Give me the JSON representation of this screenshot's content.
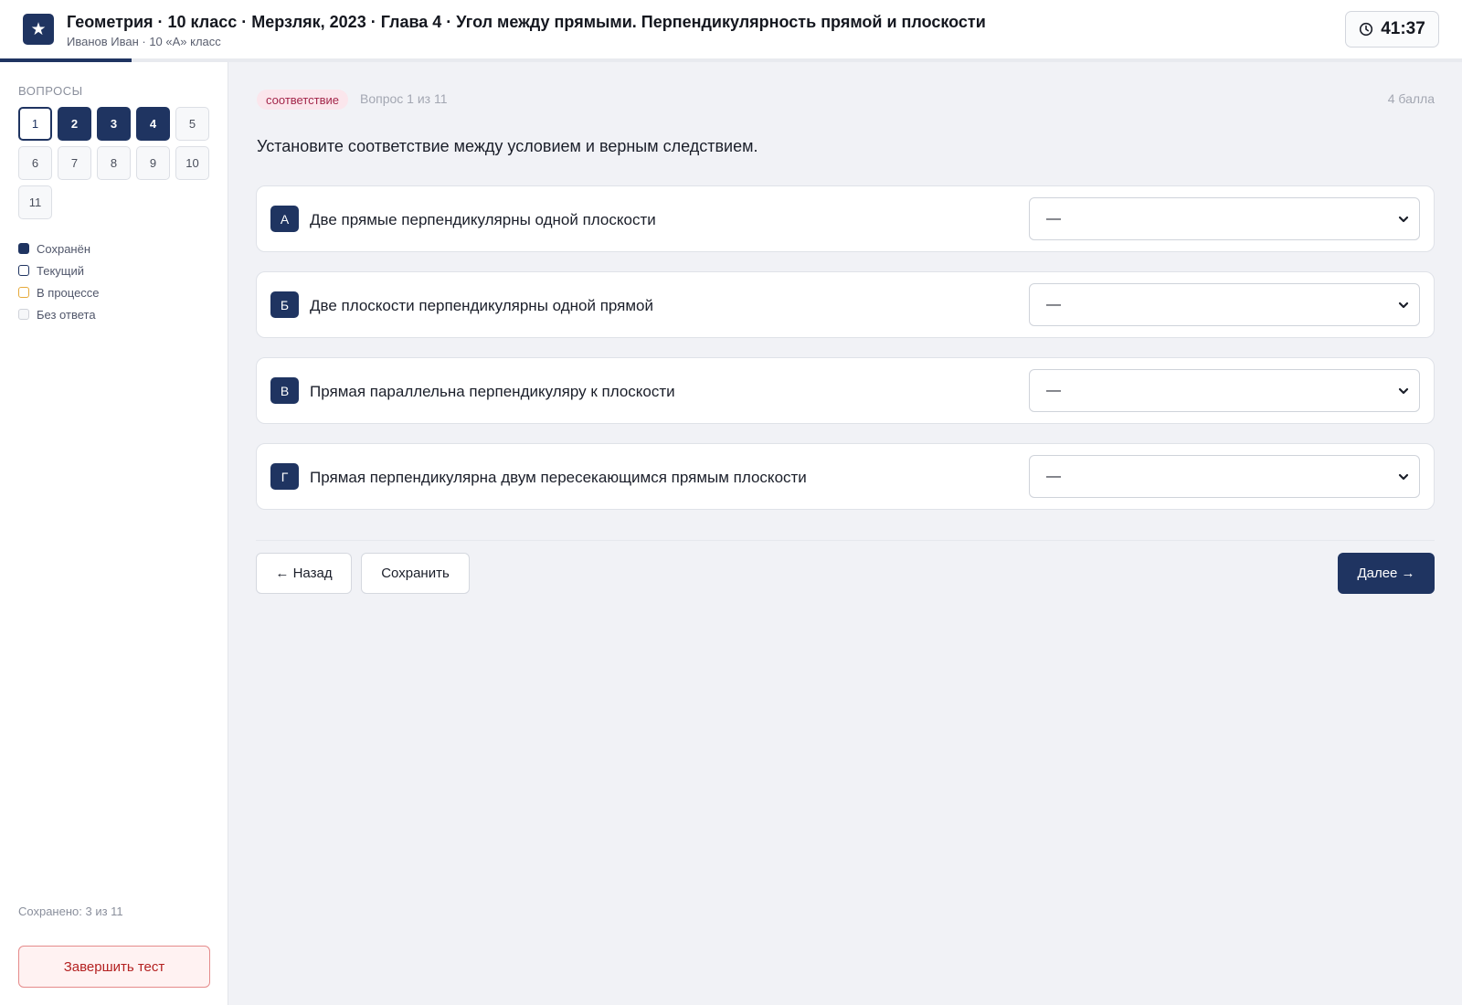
{
  "colors": {
    "primary": "#1f3461",
    "badge_bg": "#fbe6ec",
    "badge_text": "#a3264a",
    "danger": "#b42121",
    "in_progress": "#e6a93a"
  },
  "header": {
    "logo_glyph": "★",
    "title": "Геометрия · 10 класс · Мерзляк, 2023 · Глава 4 · Угол между прямыми. Перпендикулярность прямой и плоскости",
    "subtitle": "Иванов Иван · 10 «А» класс",
    "timer": "41:37",
    "timer_icon": "clock-icon"
  },
  "progress": {
    "fraction": 0.09
  },
  "sidebar": {
    "heading": "Вопросы",
    "questions": [
      {
        "label": "1",
        "state": "current"
      },
      {
        "label": "2",
        "state": "saved"
      },
      {
        "label": "3",
        "state": "saved"
      },
      {
        "label": "4",
        "state": "saved"
      },
      {
        "label": "5",
        "state": "empty"
      },
      {
        "label": "6",
        "state": "empty"
      },
      {
        "label": "7",
        "state": "empty"
      },
      {
        "label": "8",
        "state": "empty"
      },
      {
        "label": "9",
        "state": "empty"
      },
      {
        "label": "10",
        "state": "empty"
      },
      {
        "label": "11",
        "state": "empty"
      }
    ],
    "legend": [
      {
        "label": "Сохранён",
        "kind": "saved"
      },
      {
        "label": "Текущий",
        "kind": "current"
      },
      {
        "label": "В процессе",
        "kind": "progress"
      },
      {
        "label": "Без ответа",
        "kind": "empty"
      }
    ],
    "saved_count": "Сохранено: 3 из 11",
    "finish_label": "Завершить тест"
  },
  "question": {
    "type_badge": "соответствие",
    "counter": "Вопрос 1 из 11",
    "points": "4 балла",
    "text": "Установите соответствие между условием и верным следствием.",
    "rows": [
      {
        "letter": "А",
        "text": "Две прямые перпендикулярны одной плоскости",
        "selected": "—"
      },
      {
        "letter": "Б",
        "text": "Две плоскости перпендикулярны одной прямой",
        "selected": "—"
      },
      {
        "letter": "В",
        "text": "Прямая параллельна перпендикуляру к плоскости",
        "selected": "—"
      },
      {
        "letter": "Г",
        "text": "Прямая перпендикулярна двум пересекающимся прямым плоскости",
        "selected": "—"
      }
    ]
  },
  "nav": {
    "back_label": "← Назад",
    "save_label": "Сохранить",
    "next_label": "Далее →"
  }
}
